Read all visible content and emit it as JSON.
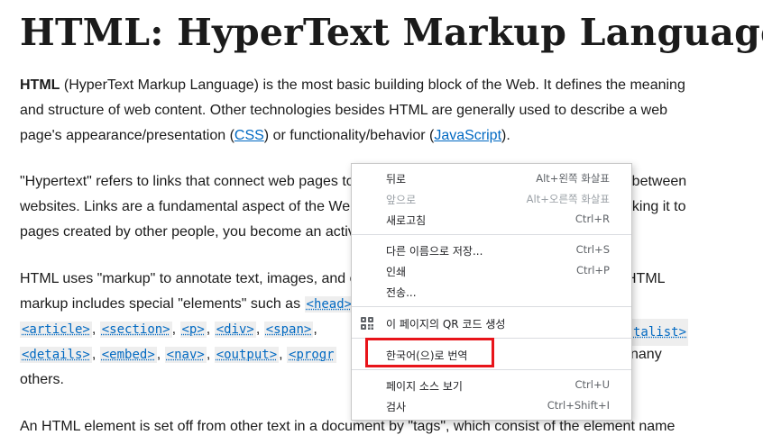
{
  "article": {
    "title": "HTML: HyperText Markup Language",
    "p1": {
      "strong": "HTML",
      "text1": " (HyperText Markup Language) is the most basic building block of the Web. It defines the meaning and structure of web content. Other technologies besides HTML are generally used to describe a web page's appearance/presentation (",
      "link_css": "CSS",
      "text2": ") or functionality/behavior (",
      "link_js": "JavaScript",
      "text3": ")."
    },
    "p2": {
      "line1": "\"Hypertext\" refers to links that connect web pages to",
      "line1_tail": "or between",
      "line2": "websites. Links are a fundamental aspect of the Wel",
      "line2_tail": "nking it to",
      "line3": "pages created by other people, you become an activ"
    },
    "p3": {
      "line1": "HTML uses \"markup\" to annotate text, images, and o",
      "line1_tail": "HTML",
      "line2": "markup includes special \"elements\" such as ",
      "tag_head": "<head>",
      "tag_article": "<article>",
      "tag_section": "<section>",
      "tag_p": "<p>",
      "tag_div": "<div>",
      "tag_span": "<span>",
      "tag_datalist_tail": "talist>",
      "tag_details": "<details>",
      "tag_embed": "<embed>",
      "tag_nav": "<nav>",
      "tag_output": "<output>",
      "tag_progr": "<progr",
      "line4_tail": "nany",
      "line5": "others."
    },
    "p4": "An HTML element is set off from other text in a document by \"tags\", which consist of the element name"
  },
  "context_menu": {
    "back": {
      "label": "뒤로",
      "shortcut": "Alt+왼쪽 화살표"
    },
    "forward": {
      "label": "앞으로",
      "shortcut": "Alt+오른쪽 화살표"
    },
    "reload": {
      "label": "새로고침",
      "shortcut": "Ctrl+R"
    },
    "save_as": {
      "label": "다른 이름으로 저장...",
      "shortcut": "Ctrl+S"
    },
    "print": {
      "label": "인쇄",
      "shortcut": "Ctrl+P"
    },
    "cast": {
      "label": "전송..."
    },
    "qr": {
      "label": "이 페이지의 QR 코드 생성"
    },
    "translate": {
      "label": "한국어(으)로 번역"
    },
    "view_source": {
      "label": "페이지 소스 보기",
      "shortcut": "Ctrl+U"
    },
    "inspect": {
      "label": "검사",
      "shortcut": "Ctrl+Shift+I"
    }
  },
  "colors": {
    "link": "#0069c2",
    "highlight": "#e8141a"
  }
}
